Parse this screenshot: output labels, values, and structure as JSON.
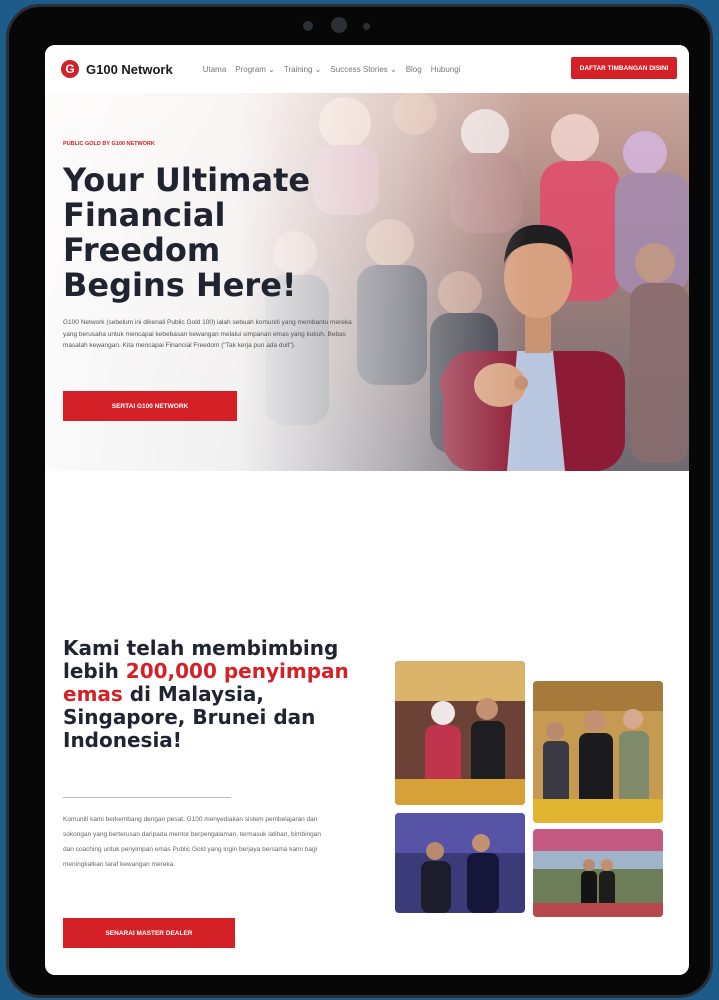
{
  "nav": {
    "logo_mark": "G",
    "logo_text": "G100 Network",
    "menu": [
      "Utama",
      "Program ⌄",
      "Training ⌄",
      "Success Stories ⌄",
      "Blog",
      "Hubungi"
    ],
    "cta_label": "DAFTAR TIMBANGAN DISINI"
  },
  "hero": {
    "eyebrow": "PUBLIC GOLD BY G100 NETWORK",
    "title_lines": [
      "Your Ultimate",
      "Financial",
      "Freedom",
      "Begins Here!"
    ],
    "body": "G100 Network (sebelum ini dikenali Public Gold 100) ialah sebuah komuniti yang membantu mereka yang berusaha untuk mencapai kebebasan kewangan melalui simpanan emas yang kukuh. Bebas masalah kewangan. Kita mencapai Financial Freedom (\"Tak kerja pun ada duit\").",
    "button_label": "SERTAI G100 NETWORK"
  },
  "section2": {
    "title_before": "Kami telah membimbing lebih ",
    "title_highlight": "200,000 penyimpan emas",
    "title_after": " di Malaysia, Singapore, Brunei dan Indonesia!",
    "body": "Komuniti kami berkembang dengan pesat. G100 menyediakan sistem pembelajaran dan sokongan yang berterusan daripada mentor berpengalaman, termasuk latihan, bimbingan dan coaching untuk penyimpan emas Public Gold yang ingin berjaya bersama kami bagi meningkatkan taraf kewangan mereka.",
    "button_label": "SENARAI MASTER DEALER"
  },
  "colors": {
    "accent": "#d42027",
    "heading": "#1f2430",
    "page_bg": "#1d5b8a"
  }
}
